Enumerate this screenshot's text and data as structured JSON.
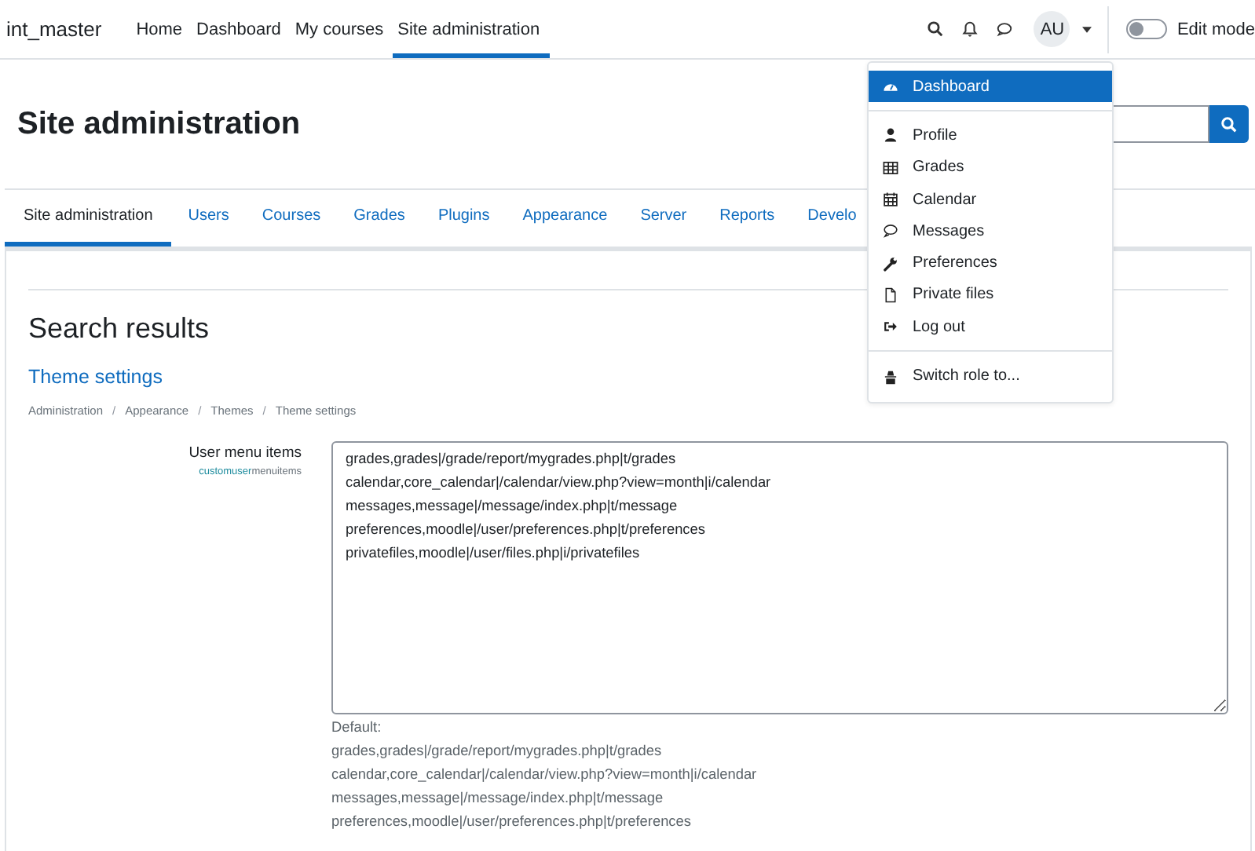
{
  "navbar": {
    "brand": "int_master",
    "links": [
      {
        "label": "Home",
        "selected": false
      },
      {
        "label": "Dashboard",
        "selected": false
      },
      {
        "label": "My courses",
        "selected": false
      },
      {
        "label": "Site administration",
        "selected": true
      }
    ],
    "avatar": "AU",
    "edit_mode": {
      "label": "Edit mode",
      "on": false
    }
  },
  "user_menu": {
    "items": [
      {
        "kind": "item",
        "label": "Dashboard",
        "selected": true
      },
      {
        "kind": "divider"
      },
      {
        "kind": "item",
        "label": "Profile",
        "selected": false
      },
      {
        "kind": "item",
        "label": "Grades",
        "selected": false
      },
      {
        "kind": "item",
        "label": "Calendar",
        "selected": false
      },
      {
        "kind": "item",
        "label": "Messages",
        "selected": false
      },
      {
        "kind": "item",
        "label": "Preferences",
        "selected": false
      },
      {
        "kind": "item",
        "label": "Private files",
        "selected": false
      },
      {
        "kind": "item",
        "label": "Log out",
        "selected": false
      },
      {
        "kind": "divider"
      },
      {
        "kind": "item",
        "label": "Switch role to...",
        "selected": false
      }
    ]
  },
  "page_title": "Site administration",
  "tabs": [
    {
      "label": "Site administration",
      "selected": true
    },
    {
      "label": "Users",
      "selected": false
    },
    {
      "label": "Courses",
      "selected": false
    },
    {
      "label": "Grades",
      "selected": false
    },
    {
      "label": "Plugins",
      "selected": false
    },
    {
      "label": "Appearance",
      "selected": false
    },
    {
      "label": "Server",
      "selected": false
    },
    {
      "label": "Reports",
      "selected": false
    },
    {
      "label": "Develo",
      "selected": false
    }
  ],
  "results_title": "Search results",
  "section_link": "Theme settings",
  "breadcrumb": [
    {
      "kind": "link",
      "text": "Administration"
    },
    {
      "kind": "separator",
      "text": "/"
    },
    {
      "kind": "link",
      "text": "Appearance"
    },
    {
      "kind": "separator",
      "text": "/"
    },
    {
      "kind": "link",
      "text": "Themes"
    },
    {
      "kind": "separator",
      "text": "/"
    },
    {
      "kind": "link",
      "text": "Theme settings"
    }
  ],
  "setting": {
    "label": "User menu items",
    "name_match": "customuser",
    "name_rest": "menuitems",
    "value": [
      "grades,grades|/grade/report/mygrades.php|t/grades",
      "calendar,core_calendar|/calendar/view.php?view=month|i/calendar",
      "messages,message|/message/index.php|t/message",
      "preferences,moodle|/user/preferences.php|t/preferences",
      "privatefiles,moodle|/user/files.php|i/privatefiles"
    ],
    "default_label": "Default:",
    "default_lines": [
      "grades,grades|/grade/report/mygrades.php|t/grades",
      "calendar,core_calendar|/calendar/view.php?view=month|i/calendar",
      "messages,message|/message/index.php|t/message",
      "preferences,moodle|/user/preferences.php|t/preferences"
    ]
  }
}
